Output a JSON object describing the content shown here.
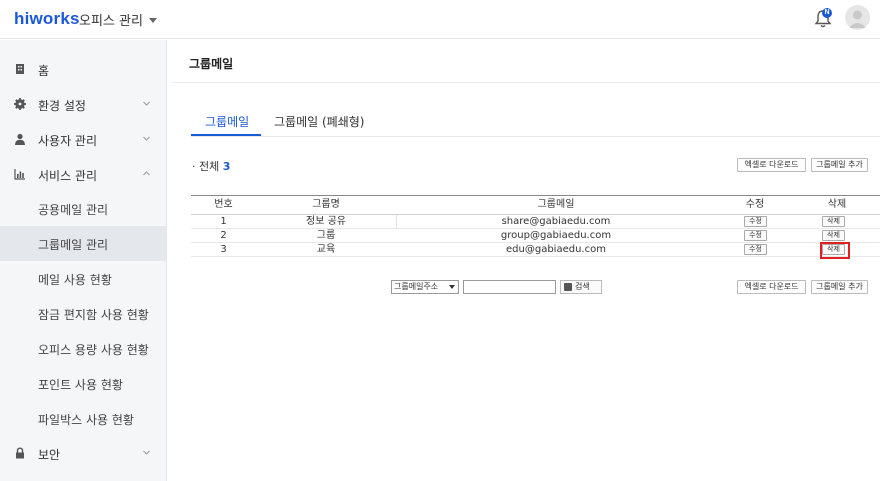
{
  "header": {
    "logo": "hiworks",
    "office_menu": "오피스 관리",
    "bell_badge": "N"
  },
  "sidebar": {
    "items": [
      {
        "label": "홈",
        "icon": "building-icon"
      },
      {
        "label": "환경 설정",
        "icon": "gear-icon"
      },
      {
        "label": "사용자 관리",
        "icon": "user-icon"
      },
      {
        "label": "서비스 관리",
        "icon": "chart-icon"
      },
      {
        "label": "보안",
        "icon": "lock-icon"
      }
    ],
    "sub_items": [
      "공용메일 관리",
      "그룹메일 관리",
      "메일 사용 현황",
      "잠금 편지함 사용 현황",
      "오피스 용량 사용 현황",
      "포인트 사용 현황",
      "파일박스 사용 현황"
    ],
    "active_sub": "그룹메일 관리"
  },
  "main": {
    "title": "그룹메일",
    "tabs": [
      "그룹메일",
      "그룹메일 (폐쇄형)"
    ],
    "total_label": "· 전체",
    "total_count": "3",
    "excel_download": "엑셀로 다운로드",
    "add_group_mail": "그룹메일 추가",
    "table": {
      "headers": [
        "번호",
        "그룹명",
        "그룹메일",
        "수정",
        "삭제"
      ],
      "edit_label": "수정",
      "delete_label": "삭제",
      "rows": [
        {
          "no": "1",
          "name": "정보 공유",
          "email": "share@gabiaedu.com"
        },
        {
          "no": "2",
          "name": "그룹",
          "email": "group@gabiaedu.com"
        },
        {
          "no": "3",
          "name": "교육",
          "email": "edu@gabiaedu.com"
        }
      ]
    },
    "search": {
      "select_value": "그룹메일주소",
      "input_value": "",
      "button_label": "검색"
    }
  },
  "colors": {
    "accent": "#1a5ad7",
    "highlight": "#e02020",
    "sidebar_bg": "#f5f6f8"
  }
}
